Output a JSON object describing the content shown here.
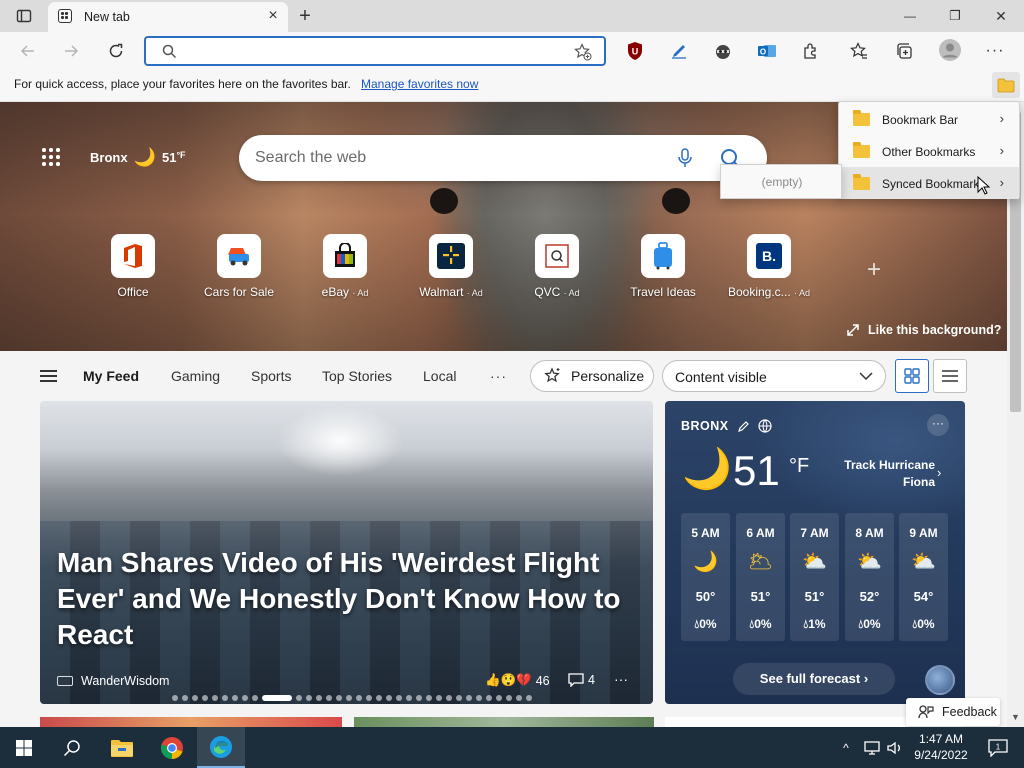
{
  "tab": {
    "title": "New tab",
    "close": "×",
    "new": "+"
  },
  "window": {
    "minimize": "—",
    "maximize": "❐",
    "close": "✕"
  },
  "address_bar": {
    "value": "",
    "placeholder": ""
  },
  "favorites_bar": {
    "message": "For quick access, place your favorites here on the favorites bar.",
    "manage_link": "Manage favorites now"
  },
  "hero": {
    "location": "Bronx",
    "temperature": "51",
    "unit": "°F",
    "search_placeholder": "Search the web",
    "like_background": "Like this background?"
  },
  "quick_links": [
    {
      "label": "Office",
      "ad": "",
      "icon": "office-icon",
      "color": "#d83b01"
    },
    {
      "label": "Cars for Sale",
      "ad": "",
      "icon": "car-icon",
      "color": "#f25022"
    },
    {
      "label": "eBay",
      "ad": "· Ad",
      "icon": "ebay-icon",
      "color": "#000000"
    },
    {
      "label": "Walmart",
      "ad": "· Ad",
      "icon": "walmart-icon",
      "color": "#0071ce"
    },
    {
      "label": "QVC",
      "ad": "· Ad",
      "icon": "qvc-icon",
      "color": "#c0392b"
    },
    {
      "label": "Travel Ideas",
      "ad": "",
      "icon": "suitcase-icon",
      "color": "#2e8ee8"
    },
    {
      "label": "Booking.c...",
      "ad": "· Ad",
      "icon": "booking-icon",
      "color": "#003580"
    }
  ],
  "bookmarks_menu": {
    "items": [
      {
        "label": "Bookmark Bar"
      },
      {
        "label": "Other Bookmarks"
      },
      {
        "label": "Synced Bookmarks"
      }
    ],
    "submenu_empty": "(empty)"
  },
  "feed_nav": {
    "tabs": [
      "My Feed",
      "Gaming",
      "Sports",
      "Top Stories",
      "Local"
    ],
    "more": "···",
    "personalize": "Personalize",
    "content_visible": "Content visible"
  },
  "hero_card": {
    "headline": "Man Shares Video of His 'Weirdest Flight Ever' and We Honestly Don't Know How to React",
    "source": "WanderWisdom",
    "reactions_count": "46",
    "comments_count": "4",
    "more": "···"
  },
  "weather_card": {
    "location": "BRONX",
    "temperature": "51",
    "unit": "°F",
    "alert": "Track Hurricane Fiona",
    "more": "···",
    "hours": [
      {
        "time": "5 AM",
        "icon": "moon",
        "temp": "50°",
        "rain": "0%"
      },
      {
        "time": "6 AM",
        "icon": "cloudy-moon",
        "temp": "51°",
        "rain": "0%"
      },
      {
        "time": "7 AM",
        "icon": "partly-sunny",
        "temp": "51°",
        "rain": "1%"
      },
      {
        "time": "8 AM",
        "icon": "partly-sunny",
        "temp": "52°",
        "rain": "0%"
      },
      {
        "time": "9 AM",
        "icon": "partly-sunny",
        "temp": "54°",
        "rain": "0%"
      }
    ],
    "forecast_button": "See full forecast"
  },
  "feedback": "Feedback",
  "taskbar": {
    "time": "1:47 AM",
    "date": "9/24/2022",
    "notifications": "1"
  },
  "colors": {
    "accent": "#2a6fc4",
    "weather_bg": "#22385a",
    "taskbar": "#1c2d3c"
  }
}
